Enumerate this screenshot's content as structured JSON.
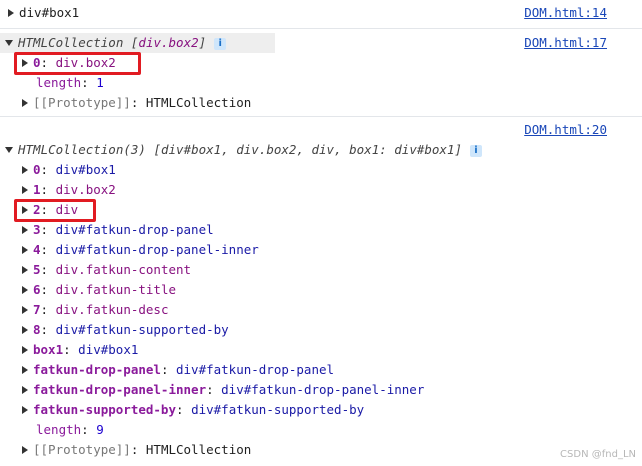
{
  "entry1": {
    "text": "div#box1",
    "source": "DOM.html:14"
  },
  "entry2": {
    "header_prefix": "HTMLCollection [",
    "header_item": "div.box2",
    "header_suffix": "]",
    "source": "DOM.html:17",
    "rows": [
      {
        "key": "0",
        "value": "div.box2"
      },
      {
        "key": "length",
        "value": "1"
      },
      {
        "key": "[[Prototype]]",
        "value": "HTMLCollection"
      }
    ]
  },
  "entry3": {
    "source": "DOM.html:20",
    "header": "HTMLCollection(3) [div#box1, div.box2, div, box1: div#box1]",
    "rows": [
      {
        "key": "0",
        "value": "div#box1"
      },
      {
        "key": "1",
        "value": "div.box2"
      },
      {
        "key": "2",
        "value": "div"
      },
      {
        "key": "3",
        "value": "div#fatkun-drop-panel"
      },
      {
        "key": "4",
        "value": "div#fatkun-drop-panel-inner"
      },
      {
        "key": "5",
        "value": "div.fatkun-content"
      },
      {
        "key": "6",
        "value": "div.fatkun-title"
      },
      {
        "key": "7",
        "value": "div.fatkun-desc"
      },
      {
        "key": "8",
        "value": "div#fatkun-supported-by"
      },
      {
        "key": "box1",
        "value": "div#box1"
      },
      {
        "key": "fatkun-drop-panel",
        "value": "div#fatkun-drop-panel"
      },
      {
        "key": "fatkun-drop-panel-inner",
        "value": "div#fatkun-drop-panel-inner"
      },
      {
        "key": "fatkun-supported-by",
        "value": "div#fatkun-supported-by"
      },
      {
        "key": "length",
        "value": "9"
      },
      {
        "key": "[[Prototype]]",
        "value": "HTMLCollection"
      }
    ]
  },
  "info_badge": "i",
  "watermark": "CSDN @fnd_LN"
}
